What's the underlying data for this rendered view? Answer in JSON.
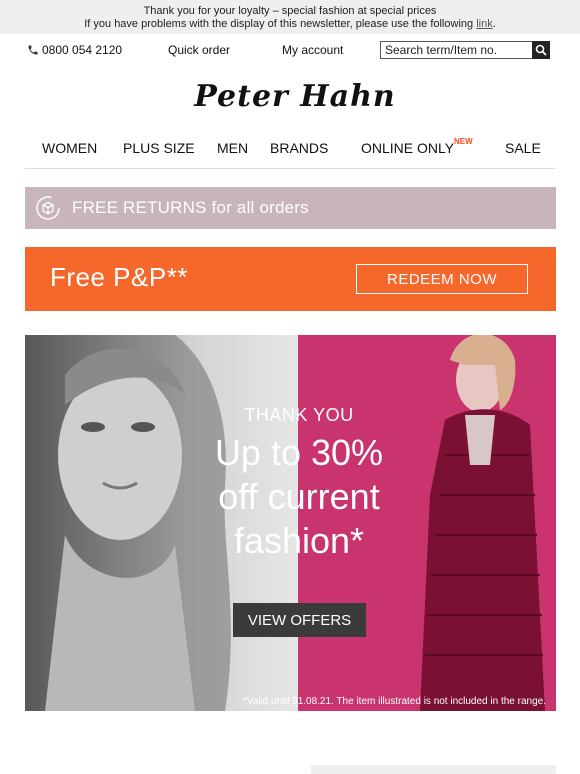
{
  "preheader": {
    "line1": "Thank you for your loyalty – special fashion at special prices",
    "line2_prefix": "If you have problems with the display of this newsletter, please use the following ",
    "link_text": "link",
    "line2_suffix": "."
  },
  "topbar": {
    "phone": "0800 054 2120",
    "quick_order": "Quick order",
    "my_account": "My account",
    "search_placeholder": "Search term/Item no."
  },
  "logo": "Peter Hahn",
  "nav": {
    "items": [
      "WOMEN",
      "PLUS SIZE",
      "MEN",
      "BRANDS",
      "ONLINE ONLY",
      "SALE"
    ],
    "online_only_badge": "NEW"
  },
  "returns_banner": {
    "text": "FREE RETURNS for all orders"
  },
  "promo": {
    "title": "Free P&P**",
    "button": "REDEEM NOW"
  },
  "hero": {
    "kicker": "THANK YOU",
    "headline_1": "Up to 30%",
    "headline_2": "off current",
    "headline_3": "fashion*",
    "button": "VIEW OFFERS",
    "disclaimer": "*Valid until 31.08.21. The item illustrated is not included in the range."
  },
  "colors": {
    "preheader_bg": "#f0eef0",
    "returns_bg": "#c7b5b9",
    "promo_bg": "#f5672b",
    "hero_pink": "#c9336e",
    "button_dark": "#3b3b3b",
    "badge": "#ff4a1c"
  },
  "icons": [
    "phone-icon",
    "search-icon",
    "return-box-icon"
  ]
}
